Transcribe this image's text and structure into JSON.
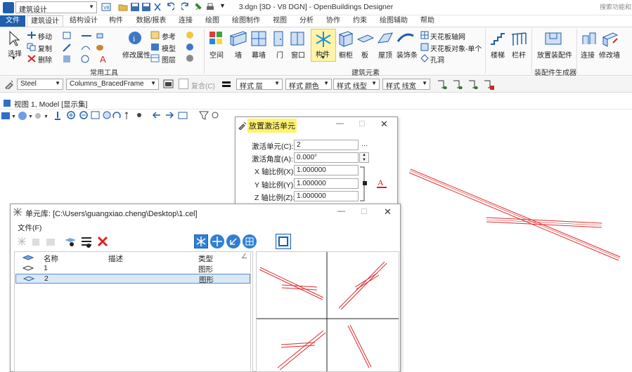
{
  "app": {
    "workspace": "建筑设计",
    "document_title": "3.dgn [3D - V8 DGN] - OpenBuildings Designer",
    "search_placeholder": "搜索功能和文档"
  },
  "tabs": [
    "文件",
    "建筑设计",
    "结构设计",
    "构件",
    "数据/报表",
    "连接",
    "绘图",
    "绘图制作",
    "视图",
    "分析",
    "协作",
    "约束",
    "绘图辅助",
    "帮助"
  ],
  "ribbon": {
    "common": {
      "select": "选择",
      "move": "移动",
      "copy": "复制",
      "delete": "删除",
      "modify_props": "修改属性",
      "reference": "参考",
      "model": "模型",
      "layer": "图层",
      "group_label": "常用工具"
    },
    "building": {
      "space": "空间",
      "wall": "墙",
      "curtain_wall": "幕墙",
      "door": "门",
      "window": "窗口",
      "component": "构件",
      "cabinet": "橱柜",
      "slab": "板",
      "roof": "屋顶",
      "finish_strip": "装饰条",
      "ceiling_grid": "天花板轴网",
      "ceiling_obj": "天花板对象-单个",
      "hole": "孔洞",
      "group_label": "建筑元素"
    },
    "stairs": "楼梯",
    "railing": "栏杆",
    "place_assembly": "放置装配件",
    "assembly_group_label": "装配件生成器",
    "connect": "连接",
    "modify_wall": "修改墙"
  },
  "toolbar2": {
    "family": "Steel",
    "part": "Columns_BracedFrame",
    "composite": "复合(C)",
    "style_layer": "样式 层",
    "style_color": "样式 颜色",
    "style_linetype": "样式 线型",
    "style_lineweight": "样式 线宽"
  },
  "view": {
    "title": "视图 1, Model [显示集]"
  },
  "place_cell_dialog": {
    "title": "放置激活单元",
    "active_cell_label": "激活单元(C):",
    "active_cell": "2",
    "browse": "...",
    "active_angle_label": "激活角度(A):",
    "active_angle": "0.000°",
    "x_scale_label": "X 轴比例(X):",
    "x_scale": "1.000000",
    "y_scale_label": "Y 轴比例(Y):",
    "y_scale": "1.000000",
    "z_scale_label": "Z 轴比例(Z):",
    "z_scale": "1.000000"
  },
  "cell_library_dialog": {
    "title": "单元库: [C:\\Users\\guangxiao.cheng\\Desktop\\1.cel]",
    "menu_file": "文件(F)",
    "columns": [
      "名称",
      "描述",
      "类型"
    ],
    "rows": [
      {
        "name": "1",
        "description": "",
        "type": "图形"
      },
      {
        "name": "2",
        "description": "",
        "type": "图形"
      }
    ],
    "selected_row": 1
  }
}
